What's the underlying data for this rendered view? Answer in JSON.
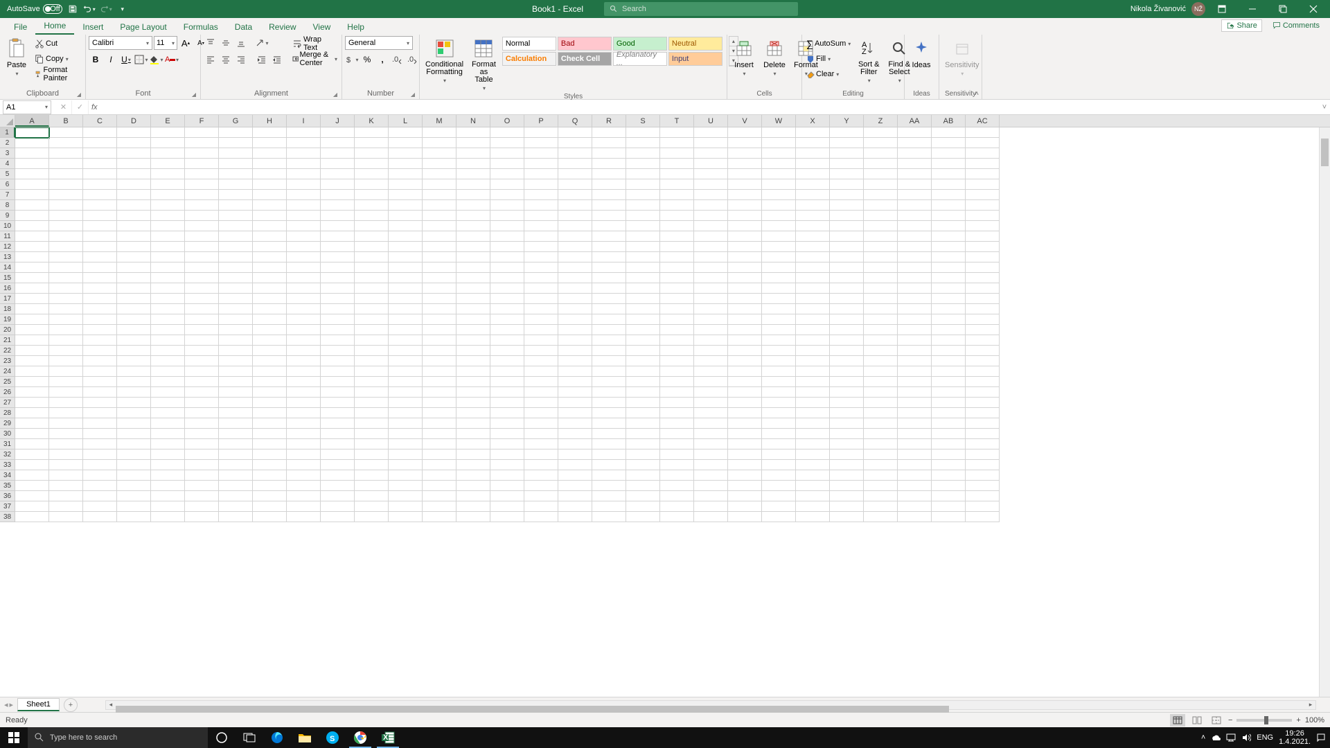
{
  "titlebar": {
    "autosave_label": "AutoSave",
    "autosave_state": "Off",
    "doc_title": "Book1  -  Excel",
    "search_placeholder": "Search",
    "username": "Nikola Živanović"
  },
  "tabs": {
    "file": "File",
    "items": [
      "Home",
      "Insert",
      "Page Layout",
      "Formulas",
      "Data",
      "Review",
      "View",
      "Help"
    ],
    "active": "Home",
    "share": "Share",
    "comments": "Comments"
  },
  "ribbon": {
    "clipboard": {
      "label": "Clipboard",
      "paste": "Paste",
      "cut": "Cut",
      "copy": "Copy",
      "painter": "Format Painter"
    },
    "font": {
      "label": "Font",
      "name": "Calibri",
      "size": "11"
    },
    "alignment": {
      "label": "Alignment",
      "wrap": "Wrap Text",
      "merge": "Merge & Center"
    },
    "number": {
      "label": "Number",
      "format": "General"
    },
    "styles": {
      "label": "Styles",
      "conditional": "Conditional Formatting",
      "table": "Format as Table",
      "normal": "Normal",
      "bad": "Bad",
      "good": "Good",
      "neutral": "Neutral",
      "calc": "Calculation",
      "check": "Check Cell",
      "expl": "Explanatory ...",
      "input": "Input"
    },
    "cells": {
      "label": "Cells",
      "insert": "Insert",
      "delete": "Delete",
      "format": "Format"
    },
    "editing": {
      "label": "Editing",
      "autosum": "AutoSum",
      "fill": "Fill",
      "clear": "Clear",
      "sort": "Sort & Filter",
      "find": "Find & Select"
    },
    "ideas": {
      "label": "Ideas",
      "btn": "Ideas"
    },
    "sensitivity": {
      "label": "Sensitivity",
      "btn": "Sensitivity"
    }
  },
  "formulabar": {
    "namebox": "A1",
    "formula": ""
  },
  "grid": {
    "columns": [
      "A",
      "B",
      "C",
      "D",
      "E",
      "F",
      "G",
      "H",
      "I",
      "J",
      "K",
      "L",
      "M",
      "N",
      "O",
      "P",
      "Q",
      "R",
      "S",
      "T",
      "U",
      "V",
      "W",
      "X",
      "Y",
      "Z",
      "AA",
      "AB",
      "AC"
    ],
    "rows": 38,
    "active_cell": "A1"
  },
  "sheets": {
    "active": "Sheet1"
  },
  "statusbar": {
    "ready": "Ready",
    "zoom": "100%"
  },
  "taskbar": {
    "search_placeholder": "Type here to search",
    "lang": "ENG",
    "time": "19:26",
    "date": "1.4.2021."
  }
}
